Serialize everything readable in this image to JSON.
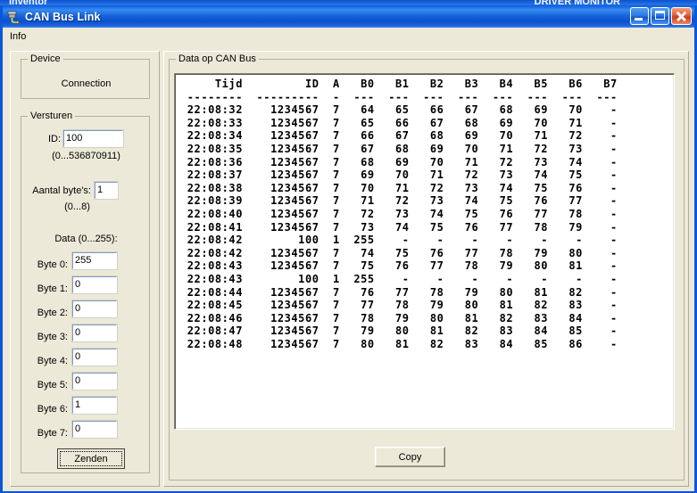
{
  "background_windows": {
    "left_title": "Inventor",
    "right_title": "DRIVER MONITOR"
  },
  "window": {
    "title": "CAN Bus Link",
    "icon": "plug-connector-icon",
    "buttons": {
      "minimize": "Minimize",
      "maximize": "Maximize",
      "close": "Close"
    }
  },
  "menubar": {
    "items": [
      {
        "label": "Info"
      }
    ]
  },
  "sidebar": {
    "device_group": {
      "caption": "Device",
      "connection_label": "Connection"
    },
    "send_group": {
      "caption": "Versturen",
      "id_label": "ID:",
      "id_value": "100",
      "id_range": "(0...536870911)",
      "count_label": "Aantal byte's:",
      "count_value": "1",
      "count_range": "(0...8)",
      "data_label": "Data (0...255):",
      "bytes": [
        {
          "label": "Byte 0:",
          "value": "255"
        },
        {
          "label": "Byte 1:",
          "value": "0"
        },
        {
          "label": "Byte 2:",
          "value": "0"
        },
        {
          "label": "Byte 3:",
          "value": "0"
        },
        {
          "label": "Byte 4:",
          "value": "0"
        },
        {
          "label": "Byte 5:",
          "value": "0"
        },
        {
          "label": "Byte 6:",
          "value": "1"
        },
        {
          "label": "Byte 7:",
          "value": "0"
        }
      ],
      "send_button": "Zenden"
    }
  },
  "data_panel": {
    "caption": "Data op CAN Bus",
    "copy_button": "Copy",
    "table": {
      "columns": [
        "Tijd",
        "ID",
        "A",
        "B0",
        "B1",
        "B2",
        "B3",
        "B4",
        "B5",
        "B6",
        "B7"
      ],
      "separator": [
        "--------",
        "---------",
        "-",
        "---",
        "---",
        "---",
        "---",
        "---",
        "---",
        "---",
        "---"
      ],
      "rows": [
        [
          "22:08:32",
          "1234567",
          "7",
          "64",
          "65",
          "66",
          "67",
          "68",
          "69",
          "70",
          "-"
        ],
        [
          "22:08:33",
          "1234567",
          "7",
          "65",
          "66",
          "67",
          "68",
          "69",
          "70",
          "71",
          "-"
        ],
        [
          "22:08:34",
          "1234567",
          "7",
          "66",
          "67",
          "68",
          "69",
          "70",
          "71",
          "72",
          "-"
        ],
        [
          "22:08:35",
          "1234567",
          "7",
          "67",
          "68",
          "69",
          "70",
          "71",
          "72",
          "73",
          "-"
        ],
        [
          "22:08:36",
          "1234567",
          "7",
          "68",
          "69",
          "70",
          "71",
          "72",
          "73",
          "74",
          "-"
        ],
        [
          "22:08:37",
          "1234567",
          "7",
          "69",
          "70",
          "71",
          "72",
          "73",
          "74",
          "75",
          "-"
        ],
        [
          "22:08:38",
          "1234567",
          "7",
          "70",
          "71",
          "72",
          "73",
          "74",
          "75",
          "76",
          "-"
        ],
        [
          "22:08:39",
          "1234567",
          "7",
          "71",
          "72",
          "73",
          "74",
          "75",
          "76",
          "77",
          "-"
        ],
        [
          "22:08:40",
          "1234567",
          "7",
          "72",
          "73",
          "74",
          "75",
          "76",
          "77",
          "78",
          "-"
        ],
        [
          "22:08:41",
          "1234567",
          "7",
          "73",
          "74",
          "75",
          "76",
          "77",
          "78",
          "79",
          "-"
        ],
        [
          "22:08:42",
          "100",
          "1",
          "255",
          "-",
          "-",
          "-",
          "-",
          "-",
          "-",
          "-"
        ],
        [
          "22:08:42",
          "1234567",
          "7",
          "74",
          "75",
          "76",
          "77",
          "78",
          "79",
          "80",
          "-"
        ],
        [
          "22:08:43",
          "1234567",
          "7",
          "75",
          "76",
          "77",
          "78",
          "79",
          "80",
          "81",
          "-"
        ],
        [
          "22:08:43",
          "100",
          "1",
          "255",
          "-",
          "-",
          "-",
          "-",
          "-",
          "-",
          "-"
        ],
        [
          "22:08:44",
          "1234567",
          "7",
          "76",
          "77",
          "78",
          "79",
          "80",
          "81",
          "82",
          "-"
        ],
        [
          "22:08:45",
          "1234567",
          "7",
          "77",
          "78",
          "79",
          "80",
          "81",
          "82",
          "83",
          "-"
        ],
        [
          "22:08:46",
          "1234567",
          "7",
          "78",
          "79",
          "80",
          "81",
          "82",
          "83",
          "84",
          "-"
        ],
        [
          "22:08:47",
          "1234567",
          "7",
          "79",
          "80",
          "81",
          "82",
          "83",
          "84",
          "85",
          "-"
        ],
        [
          "22:08:48",
          "1234567",
          "7",
          "80",
          "81",
          "82",
          "83",
          "84",
          "85",
          "86",
          "-"
        ]
      ]
    }
  },
  "colors": {
    "titlebar_blue": "#0a5ae0",
    "window_face": "#ece9d8",
    "frame_blue": "#0a58d6",
    "close_red": "#cf3a1a"
  }
}
